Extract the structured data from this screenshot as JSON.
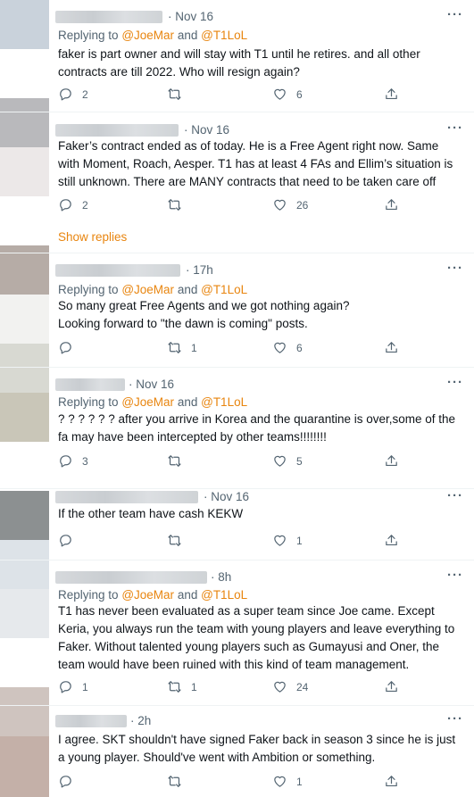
{
  "tweets": [
    {
      "time": "· Nov 16",
      "replying_prefix": "Replying to",
      "mention1": "@JoeMar",
      "and": "and",
      "mention2": "@T1LoL",
      "text": [
        "faker is part owner and will stay with T1 until he retires. and all other contracts are till 2022. Who will resign again?"
      ],
      "replies": "2",
      "retweets": "",
      "likes": "6"
    },
    {
      "time": "· Nov 16",
      "replying_prefix": "",
      "mention1": "",
      "and": "",
      "mention2": "",
      "text": [
        "Faker’s contract ended as of today. He is a Free Agent right now. Same with Moment, Roach, Aesper. T1 has at least 4 FAs and Ellim’s situation is still unknown. There are MANY contracts that need to be taken care off"
      ],
      "replies": "2",
      "retweets": "",
      "likes": "26"
    },
    {
      "time": "· 17h",
      "replying_prefix": "Replying to",
      "mention1": "@JoeMar",
      "and": "and",
      "mention2": "@T1LoL",
      "text": [
        "So many great Free Agents and we got nothing again?",
        "Looking forward to \"the dawn is coming\" posts."
      ],
      "replies": "",
      "retweets": "1",
      "likes": "6"
    },
    {
      "time": "· Nov 16",
      "replying_prefix": "Replying to",
      "mention1": "@JoeMar",
      "and": "and",
      "mention2": "@T1LoL",
      "text": [
        "? ? ? ? ? ? after you arrive in Korea and the quarantine is over,some of the fa may have been intercepted by other teams!!!!!!!!"
      ],
      "replies": "3",
      "retweets": "",
      "likes": "5"
    },
    {
      "time": "· Nov 16",
      "replying_prefix": "",
      "mention1": "",
      "and": "",
      "mention2": "",
      "text": [
        "If the other team have cash KEKW"
      ],
      "replies": "",
      "retweets": "",
      "likes": "1"
    },
    {
      "time": "· 8h",
      "replying_prefix": "Replying to",
      "mention1": "@JoeMar",
      "and": "and",
      "mention2": "@T1LoL",
      "text": [
        "T1 has never been evaluated as a super team since Joe came. Except Keria, you always run the team with young players and leave everything to Faker. Without talented young players such as Gumayusi and Oner, the team would have been ruined with this kind of team management."
      ],
      "replies": "1",
      "retweets": "1",
      "likes": "24"
    },
    {
      "time": "· 2h",
      "replying_prefix": "",
      "mention1": "",
      "and": "",
      "mention2": "",
      "text": [
        "I agree. SKT shouldn't have signed Faker back in season 3 since he is just a young player. Should've went with Ambition or something."
      ],
      "replies": "",
      "retweets": "",
      "likes": "1"
    }
  ],
  "show_replies": "Show replies",
  "more_label": "···",
  "icons": [
    "reply-icon",
    "retweet-icon",
    "like-icon",
    "share-icon",
    "more-icon"
  ],
  "colors": {
    "accent": "#e8850f",
    "muted": "#536471",
    "text": "#0f1419"
  }
}
